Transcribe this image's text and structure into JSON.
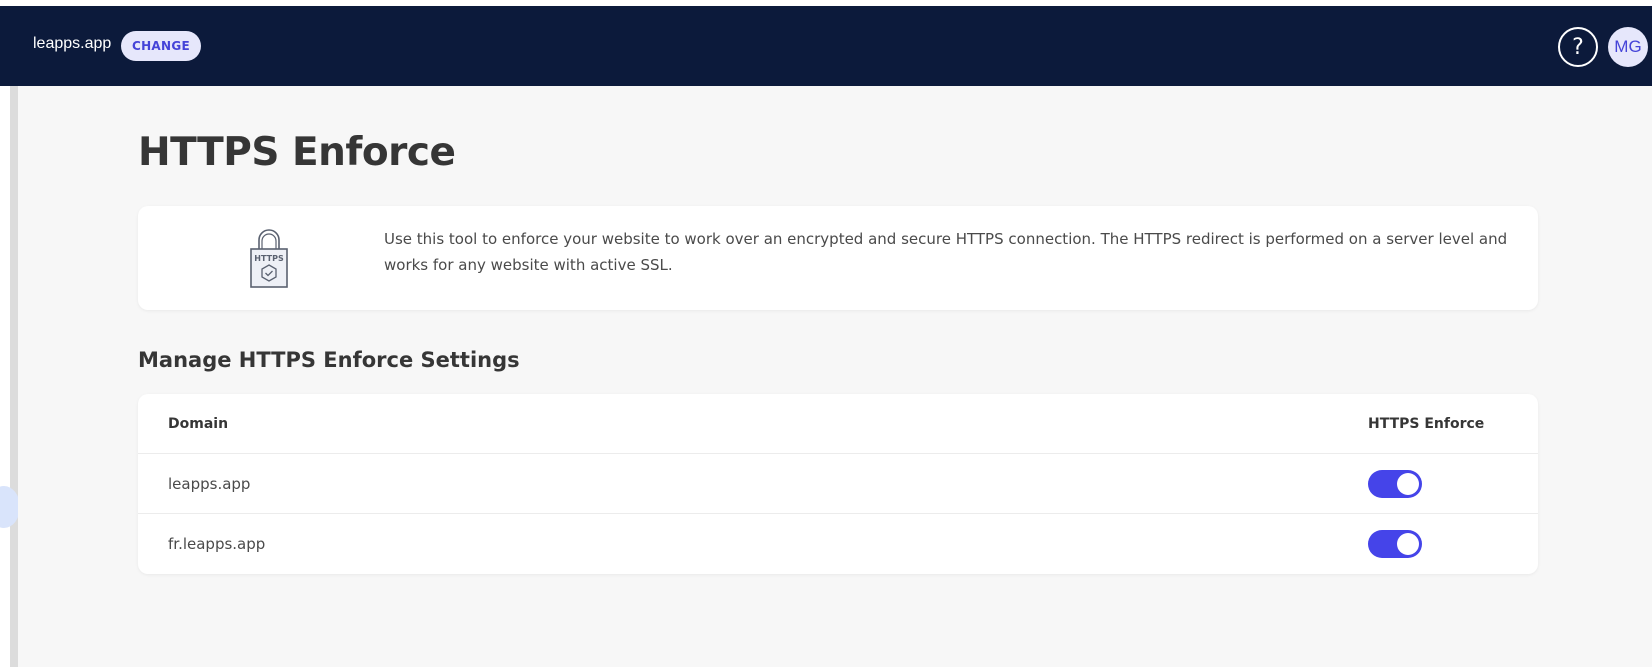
{
  "header": {
    "site_name": "leapps.app",
    "change_label": "CHANGE",
    "help_label": "?",
    "avatar_initials": "MG"
  },
  "page": {
    "title": "HTTPS Enforce",
    "description": "Use this tool to enforce your website to work over an encrypted and secure HTTPS connection. The HTTPS redirect is performed on a server level and works for any website with active SSL.",
    "lock_label": "HTTPS"
  },
  "settings": {
    "title": "Manage HTTPS Enforce Settings",
    "columns": {
      "domain": "Domain",
      "enforce": "HTTPS Enforce"
    },
    "rows": [
      {
        "domain": "leapps.app",
        "enabled": true
      },
      {
        "domain": "fr.leapps.app",
        "enabled": true
      }
    ]
  },
  "colors": {
    "header_bg": "#0c1a3b",
    "accent": "#4544e9",
    "badge_bg": "#e6e7fb"
  },
  "icons": [
    "help-icon",
    "lock-https-icon"
  ]
}
